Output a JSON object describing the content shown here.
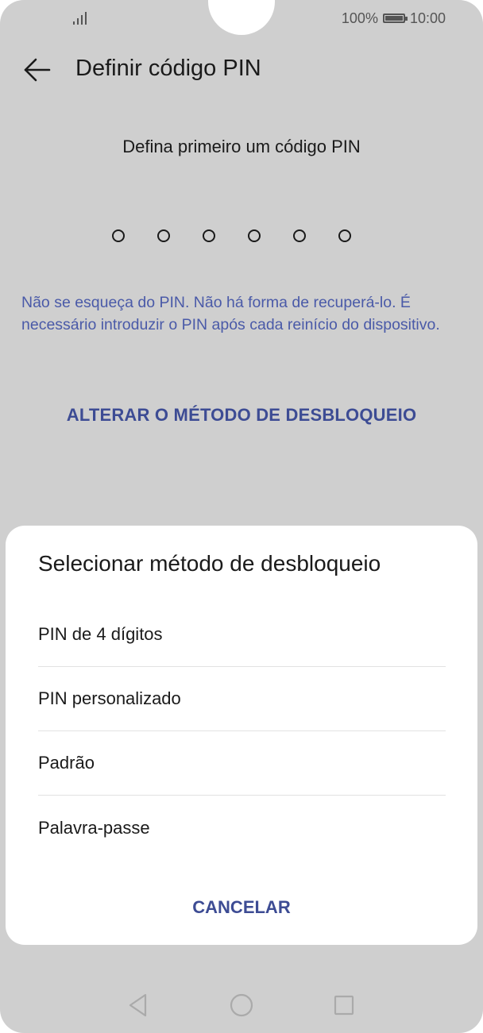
{
  "status_bar": {
    "battery_percent": "100%",
    "time": "10:00"
  },
  "header": {
    "title": "Definir código PIN"
  },
  "main": {
    "prompt": "Defina primeiro um código PIN",
    "pin_length": 6,
    "warning": "Não se esqueça do PIN. Não há forma de recuperá-lo. É necessário introduzir o PIN após cada reinício do dispositivo.",
    "change_method_label": "ALTERAR O MÉTODO DE DESBLOQUEIO"
  },
  "sheet": {
    "title": "Selecionar método de desbloqueio",
    "options": [
      "PIN de 4 dígitos",
      "PIN personalizado",
      "Padrão",
      "Palavra-passe"
    ],
    "cancel_label": "CANCELAR"
  },
  "colors": {
    "accent": "#3d4c94",
    "warning_text": "#4a5aa8",
    "dimmed_background": "#cfcfcf"
  },
  "icons": {
    "back": "arrow-left-icon",
    "signal": "signal-icon",
    "battery": "battery-icon",
    "nav_back": "triangle-back-icon",
    "nav_home": "circle-home-icon",
    "nav_recents": "square-recents-icon"
  }
}
